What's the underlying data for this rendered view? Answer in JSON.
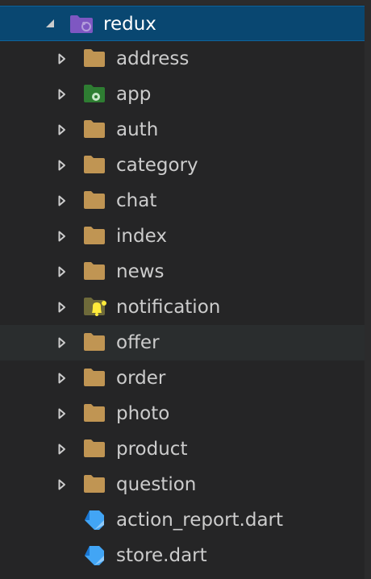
{
  "explorer": {
    "root": {
      "label": "redux",
      "icon": "folder-redux-icon",
      "expanded": true
    },
    "items": [
      {
        "label": "address",
        "icon": "folder-icon"
      },
      {
        "label": "app",
        "icon": "folder-app-icon"
      },
      {
        "label": "auth",
        "icon": "folder-icon"
      },
      {
        "label": "category",
        "icon": "folder-icon"
      },
      {
        "label": "chat",
        "icon": "folder-icon"
      },
      {
        "label": "index",
        "icon": "folder-icon"
      },
      {
        "label": "news",
        "icon": "folder-icon"
      },
      {
        "label": "notification",
        "icon": "folder-notification-icon"
      },
      {
        "label": "offer",
        "icon": "folder-icon"
      },
      {
        "label": "order",
        "icon": "folder-icon"
      },
      {
        "label": "photo",
        "icon": "folder-icon"
      },
      {
        "label": "product",
        "icon": "folder-icon"
      },
      {
        "label": "question",
        "icon": "folder-icon"
      }
    ],
    "files": [
      {
        "label": "action_report.dart",
        "icon": "dart-file-icon"
      },
      {
        "label": "store.dart",
        "icon": "dart-file-icon"
      }
    ]
  },
  "colors": {
    "background": "#252526",
    "selection": "#094771",
    "hover": "#2a2d2e",
    "folder": "#c09553",
    "redux_folder": "#7e57c2",
    "app_folder": "#2e7d32",
    "notification_bell": "#ffeb3b",
    "dart": "#42a5f5"
  }
}
